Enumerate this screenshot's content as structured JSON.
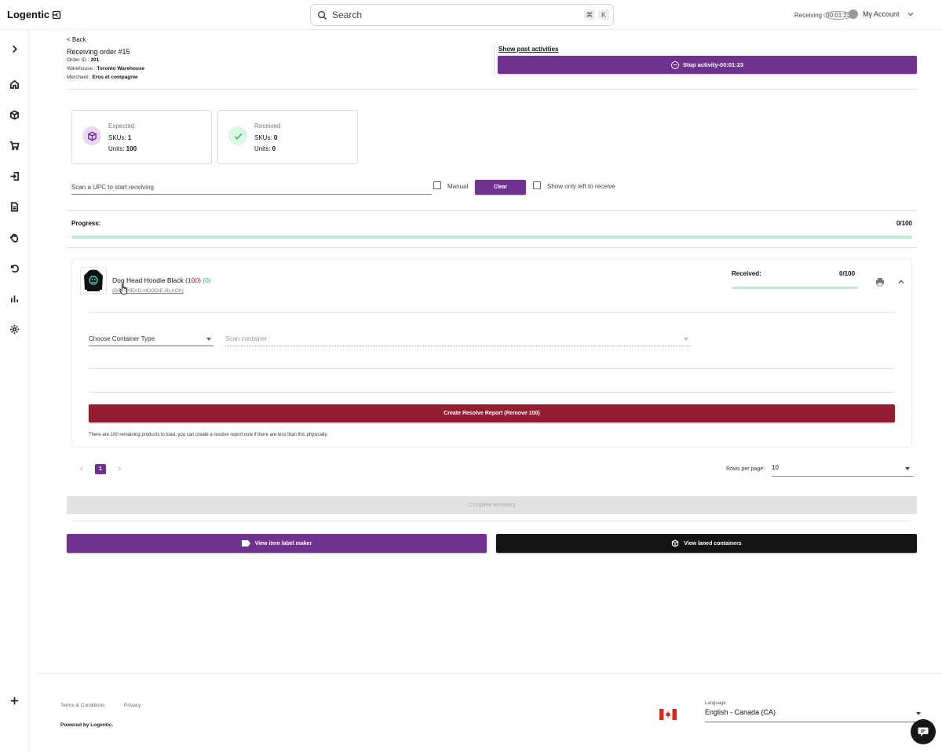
{
  "app": {
    "logo": "Logentic"
  },
  "search": {
    "placeholder": "Search",
    "kbd1": "⌘",
    "kbd2": "K"
  },
  "header": {
    "receiving_label": "Receiving",
    "receiving_timer": "00:01:23",
    "account_label": "My Account"
  },
  "order": {
    "back_label": "< Back",
    "title": "Receiving order #15",
    "order_id_label": "Order ID : ",
    "order_id": "201",
    "warehouse_label": "Warehouse : ",
    "warehouse": "Toronto Warehouse",
    "merchant_label": "Merchant : ",
    "merchant": "Eros et compagnie",
    "past_activities": "Show past activities",
    "stop_activity": "Stop activity-00:01:23"
  },
  "stats": {
    "expected": {
      "label": "Expected",
      "skus_label": "SKUs: ",
      "skus": "1",
      "units_label": "Units: ",
      "units": "100"
    },
    "received": {
      "label": "Received",
      "skus_label": "SKUs: ",
      "skus": "0",
      "units_label": "Units: ",
      "units": "0"
    }
  },
  "scan": {
    "placeholder": "Scan a UPC to start receiving",
    "manual_label": "Manual",
    "clear_label": "Clear",
    "show_left_label": "Show only left to receive"
  },
  "progress": {
    "label": "Progress:",
    "value_text": "0/100",
    "fraction": 0
  },
  "product": {
    "name": "Dog Head Hoodie Black ",
    "expected_count": "(100)",
    "received_count": "(0)",
    "sku": "(DOG-HEAD-HOODIE-BLACK)",
    "received_label": "Received:",
    "received_value": "0/100",
    "received_fraction": 0,
    "container_type_placeholder": "Choose Container Type",
    "scan_container_placeholder": "Scan container",
    "resolve_button": "Create Resolve Report (Remove 100)",
    "note": "There are 100 remaining products to load, you can create a resolve report now if there are less than this physically."
  },
  "pagination": {
    "current_page": "1",
    "rows_label": "Rows per page:",
    "rows_value": "10"
  },
  "actions": {
    "complete": "Complete receiving",
    "label_maker": "View item label maker",
    "laned_containers": "View laned containers"
  },
  "footer": {
    "terms": "Terms & Conditions",
    "privacy": "Privacy",
    "powered": "Powered by Logentic.",
    "language_label": "Language",
    "language_value": "English - Canada (CA)"
  },
  "colors": {
    "accent": "#6f3290",
    "danger": "#941c31",
    "success": "#2db36f",
    "progress": "#b9ecd0"
  }
}
